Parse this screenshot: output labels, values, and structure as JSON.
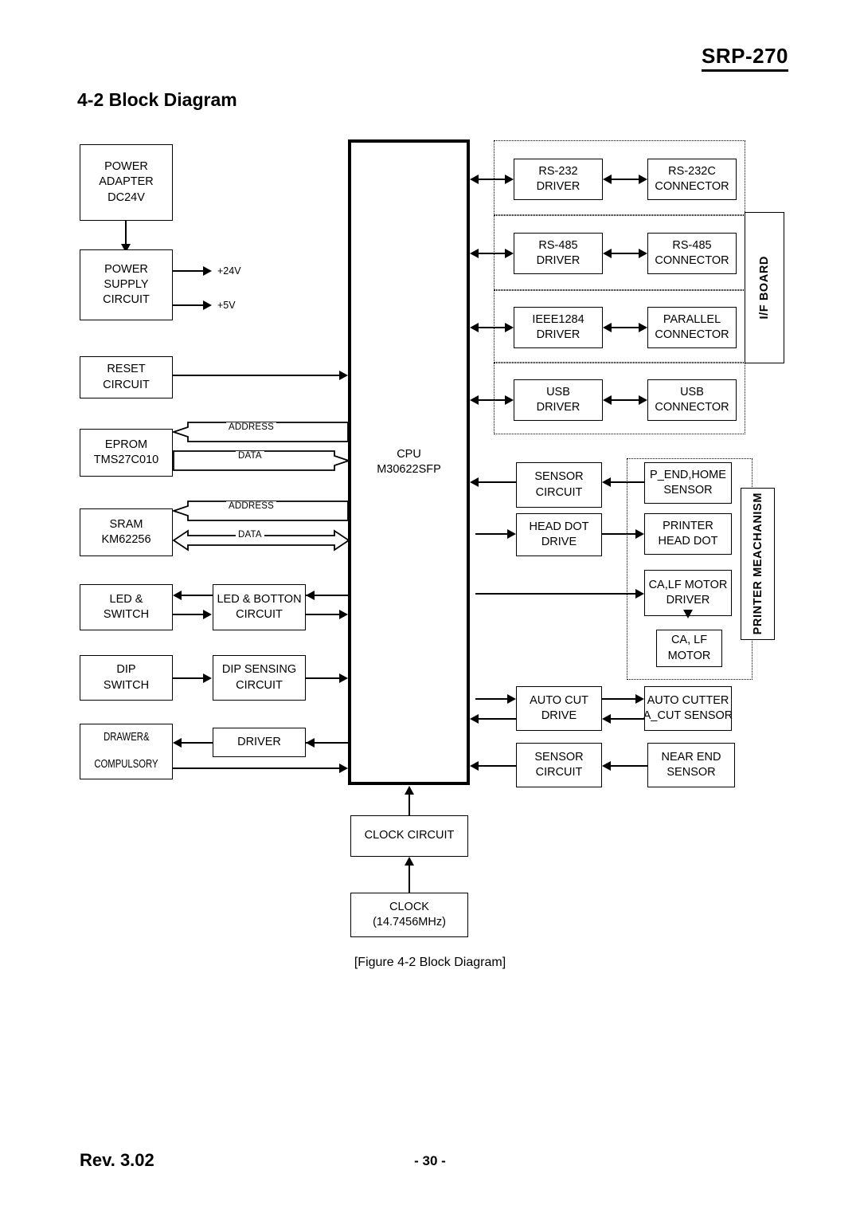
{
  "header": {
    "product_title": "SRP-270"
  },
  "section": {
    "number_title": "4-2 Block Diagram"
  },
  "caption": {
    "text": "[Figure 4-2 Block Diagram]"
  },
  "footer": {
    "revision": "Rev. 3.02",
    "page": "- 30 -"
  },
  "cpu": {
    "line1": "CPU",
    "line2": "M30622SFP"
  },
  "power": {
    "adapter": {
      "line1": "POWER",
      "line2": "ADAPTER",
      "line3": "DC24V"
    },
    "supply": {
      "line1": "POWER",
      "line2": "SUPPLY",
      "line3": "CIRCUIT"
    },
    "rail_24v": "+24V",
    "rail_5v": "+5V"
  },
  "left_blocks": [
    {
      "id": "reset",
      "line1": "RESET",
      "line2": "CIRCUIT"
    },
    {
      "id": "eprom",
      "line1": "EPROM",
      "line2": "TMS27C010"
    },
    {
      "id": "sram",
      "line1": "SRAM",
      "line2": "KM62256"
    },
    {
      "id": "led_switch",
      "line1": "LED &",
      "line2": "SWITCH"
    },
    {
      "id": "dip_switch",
      "line1": "DIP",
      "line2": "SWITCH"
    },
    {
      "id": "drawer",
      "line1": "DRAWER&",
      "line2": "COMPULSORY"
    }
  ],
  "left_mid_blocks": [
    {
      "id": "led_button_circuit",
      "line1": "LED & BOTTON",
      "line2": "CIRCUIT"
    },
    {
      "id": "dip_sensing_circuit",
      "line1": "DIP SENSING",
      "line2": "CIRCUIT"
    },
    {
      "id": "driver",
      "line1": "DRIVER",
      "line2": ""
    }
  ],
  "bus_labels": {
    "eprom_address": "ADDRESS",
    "eprom_data": "DATA",
    "sram_address": "ADDRESS",
    "sram_data": "DATA"
  },
  "if_board": {
    "label": "I/F BOARD",
    "rows": [
      {
        "driver_line1": "RS-232",
        "driver_line2": "DRIVER",
        "conn_line1": "RS-232C",
        "conn_line2": "CONNECTOR"
      },
      {
        "driver_line1": "RS-485",
        "driver_line2": "DRIVER",
        "conn_line1": "RS-485",
        "conn_line2": "CONNECTOR"
      },
      {
        "driver_line1": "IEEE1284",
        "driver_line2": "DRIVER",
        "conn_line1": "PARALLEL",
        "conn_line2": "CONNECTOR"
      },
      {
        "driver_line1": "USB",
        "driver_line2": "DRIVER",
        "conn_line1": "USB",
        "conn_line2": "CONNECTOR"
      }
    ]
  },
  "printer_mechanism": {
    "label": "PRINTER MEACHANISM",
    "sensor_circuit": {
      "line1": "SENSOR",
      "line2": "CIRCUIT"
    },
    "p_end_home_sensor": {
      "line1": "P_END,HOME",
      "line2": "SENSOR"
    },
    "head_dot_drive": {
      "line1": "HEAD DOT",
      "line2": "DRIVE"
    },
    "printer_head_dot": {
      "line1": "PRINTER",
      "line2": "HEAD DOT"
    },
    "ca_lf_motor_driver": {
      "line1": "CA,LF MOTOR",
      "line2": "DRIVER"
    },
    "ca_lf_motor": {
      "line1": "CA, LF",
      "line2": "MOTOR"
    }
  },
  "cutter": {
    "auto_cut_drive": {
      "line1": "AUTO CUT",
      "line2": "DRIVE"
    },
    "auto_cutter_sensor": {
      "line1": "AUTO CUTTER",
      "line2": "A_CUT SENSOR"
    },
    "sensor_circuit": {
      "line1": "SENSOR",
      "line2": "CIRCUIT"
    },
    "near_end_sensor": {
      "line1": "NEAR END",
      "line2": "SENSOR"
    }
  },
  "clock": {
    "circuit": {
      "line1": "CLOCK CIRCUIT",
      "line2": ""
    },
    "source": {
      "line1": "CLOCK",
      "line2": "(14.7456MHz)"
    }
  },
  "colors": {
    "ink": "#000000",
    "paper": "#ffffff"
  }
}
